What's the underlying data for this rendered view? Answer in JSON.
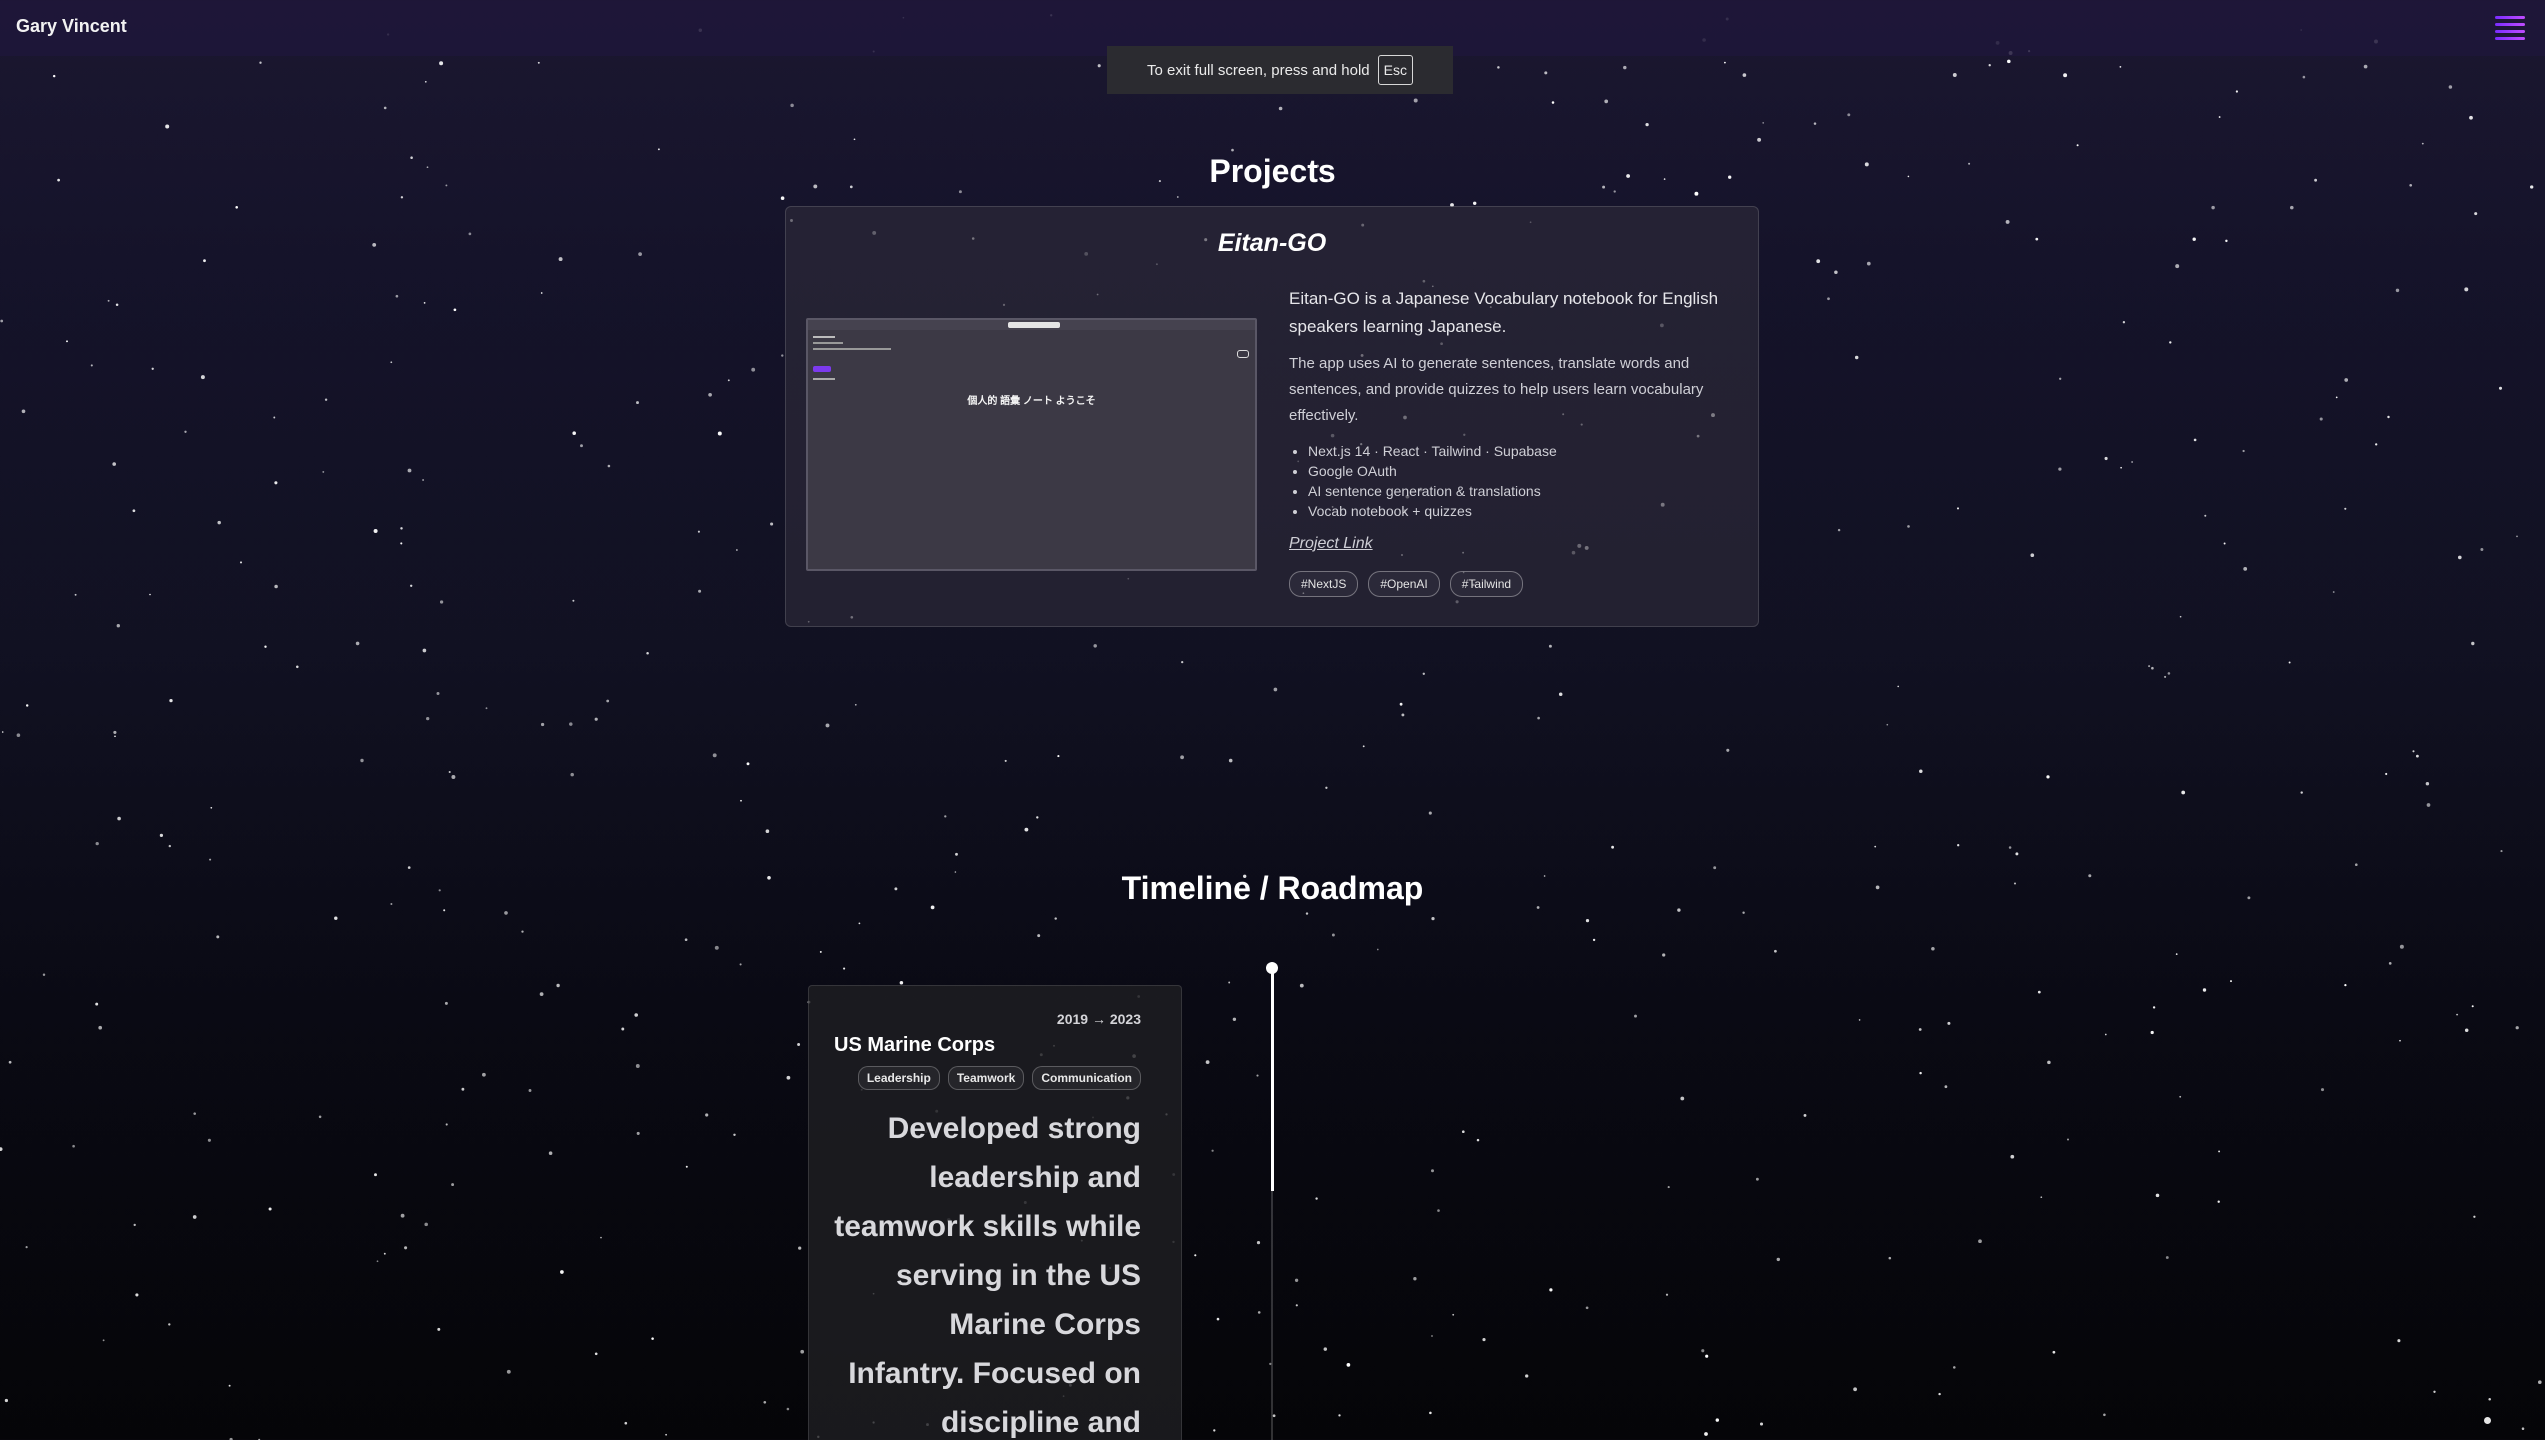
{
  "header": {
    "brand": "Gary Vincent",
    "menu_icon": "hamburger-menu-icon",
    "accent_color": "#8b2cff"
  },
  "fullscreen_notice": {
    "text": "To exit full screen, press and hold",
    "key": "Esc"
  },
  "projects": {
    "title": "Projects",
    "items": [
      {
        "name": "Eitan-GO",
        "screenshot_heading": "個人的 語彙 ノート ようこそ",
        "description_1": "Eitan-GO is a Japanese Vocabulary notebook for English speakers learning Japanese.",
        "description_2": "The app uses AI to generate sentences, translate words and sentences, and provide quizzes to help users learn vocabulary effectively.",
        "features": [
          "Next.js 14 · React · Tailwind · Supabase",
          "Google OAuth",
          "AI sentence generation & translations",
          "Vocab notebook + quizzes"
        ],
        "link_label": "Project Link",
        "tags": [
          "#NextJS",
          "#OpenAI",
          "#Tailwind"
        ]
      }
    ]
  },
  "timeline": {
    "title": "Timeline / Roadmap",
    "entries": [
      {
        "dates": "2019 → 2023",
        "title": "US Marine Corps",
        "tags": [
          "Leadership",
          "Teamwork",
          "Communication"
        ],
        "description": "Developed strong leadership and teamwork skills while serving in the US Marine Corps Infantry. Focused on discipline and"
      }
    ]
  }
}
